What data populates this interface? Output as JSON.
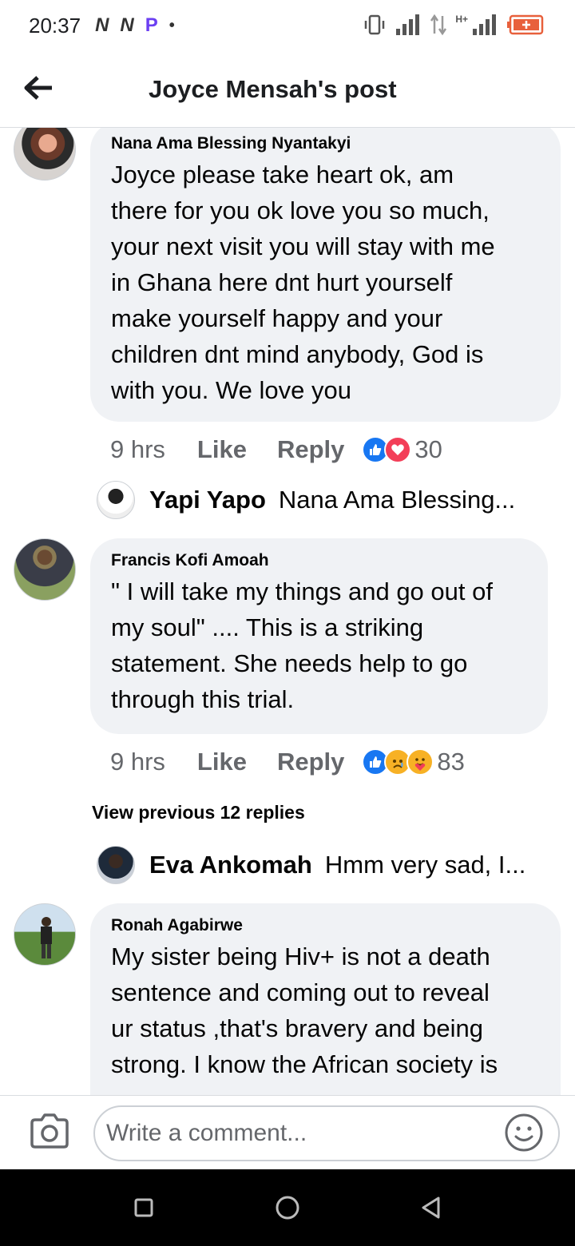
{
  "status_bar": {
    "time": "20:37",
    "left_icons": [
      "N",
      "N",
      "P",
      "•"
    ],
    "right_icons": [
      "vibrate-icon",
      "signal-icon",
      "data-arrows-icon",
      "H+",
      "battery-icon"
    ],
    "network_label": "H+"
  },
  "header": {
    "title": "Joyce Mensah's post"
  },
  "comments": [
    {
      "author": "Nana Ama Blessing Nyantakyi",
      "lines": [
        "Joyce please take heart ok, am",
        "there for you ok  love you so much,",
        "your next visit you will stay with me",
        "in Ghana here dnt hurt yourself",
        "make  yourself happy and your",
        "children dnt mind anybody, God is",
        "with you. We love you"
      ],
      "time": "9 hrs",
      "like_label": "Like",
      "reply_label": "Reply",
      "reactions": [
        "like",
        "love"
      ],
      "reaction_count": "30",
      "reply_preview": {
        "author": "Yapi Yapo",
        "text": "Nana Ama Blessing..."
      }
    },
    {
      "author": "Francis Kofi Amoah",
      "lines": [
        "\" I will take my things and go out of",
        "my soul\" .... This is a striking",
        "statement. She needs help to go",
        "through this trial."
      ],
      "time": "9 hrs",
      "like_label": "Like",
      "reply_label": "Reply",
      "reactions": [
        "like",
        "sad",
        "care"
      ],
      "reaction_count": "83",
      "view_previous": "View previous 12 replies",
      "reply_preview": {
        "author": "Eva Ankomah",
        "text": "Hmm very sad, I..."
      }
    },
    {
      "author": "Ronah Agabirwe",
      "lines": [
        "My sister being Hiv+ is not a death",
        "sentence and coming out to reveal",
        "ur status ,that's bravery and being",
        "strong. I know the African society is"
      ]
    }
  ],
  "composer": {
    "placeholder": "Write a comment..."
  },
  "colors": {
    "bubble": "#f0f2f5",
    "meta_text": "#65676b",
    "like_blue": "#1877f2",
    "love_red": "#f33e58",
    "emoji_yellow": "#f7b125"
  }
}
